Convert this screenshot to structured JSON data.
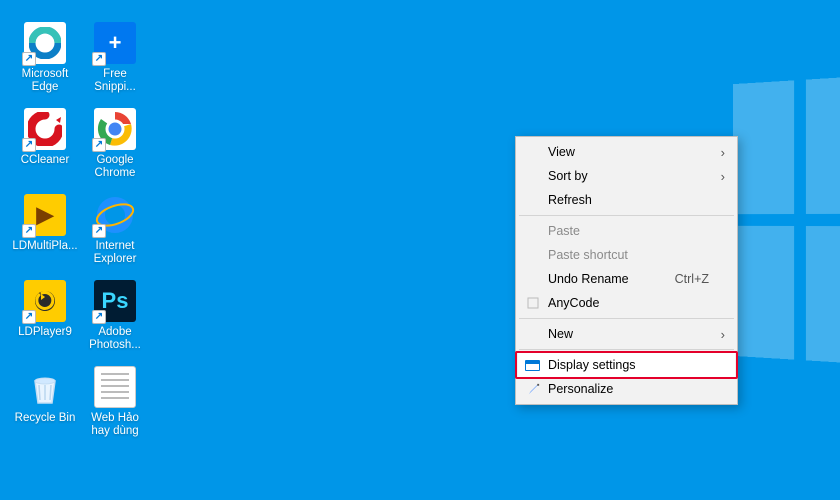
{
  "desktop": {
    "icons": [
      [
        {
          "label": "Microsoft Edge",
          "key": "edge",
          "glyph": "e"
        },
        {
          "label": "Free Snippi...",
          "key": "snip",
          "glyph": "+"
        }
      ],
      [
        {
          "label": "CCleaner",
          "key": "cc"
        },
        {
          "label": "Google Chrome",
          "key": "chrome"
        }
      ],
      [
        {
          "label": "LDMultiPla...",
          "key": "ld",
          "glyph": "▶"
        },
        {
          "label": "Internet Explorer",
          "key": "ie",
          "glyph": "e"
        }
      ],
      [
        {
          "label": "LDPlayer9",
          "key": "ldp"
        },
        {
          "label": "Adobe Photosh...",
          "key": "ps",
          "glyph": "Ps"
        }
      ],
      [
        {
          "label": "Recycle Bin",
          "key": "bin"
        },
        {
          "label": "Web Hảo hay dùng",
          "key": "doc"
        }
      ]
    ]
  },
  "context_menu": {
    "items": [
      {
        "label": "View",
        "submenu": true
      },
      {
        "label": "Sort by",
        "submenu": true
      },
      {
        "label": "Refresh"
      },
      {
        "sep": true
      },
      {
        "label": "Paste",
        "disabled": true
      },
      {
        "label": "Paste shortcut",
        "disabled": true
      },
      {
        "label": "Undo Rename",
        "shortcut": "Ctrl+Z"
      },
      {
        "label": "AnyCode",
        "icon": "anycode"
      },
      {
        "sep": true
      },
      {
        "label": "New",
        "submenu": true
      },
      {
        "sep": true
      },
      {
        "label": "Display settings",
        "icon": "monitor",
        "highlight": true
      },
      {
        "label": "Personalize",
        "icon": "personalize"
      }
    ]
  }
}
